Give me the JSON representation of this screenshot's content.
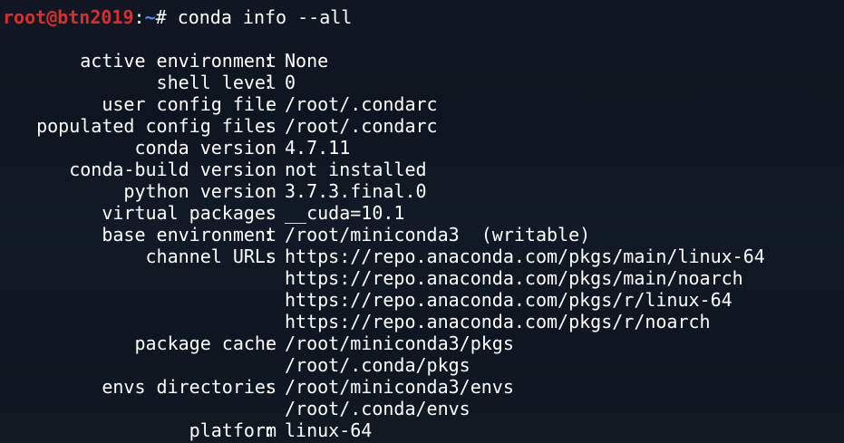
{
  "prompt": {
    "user_host": "root@btn2019",
    "sep": ":",
    "path": "~",
    "symbol": "# ",
    "command": "conda info --all"
  },
  "info": [
    {
      "key": "active environment",
      "value": "None"
    },
    {
      "key": "shell level",
      "value": "0"
    },
    {
      "key": "user config file",
      "value": "/root/.condarc"
    },
    {
      "key": "populated config files",
      "value": "/root/.condarc"
    },
    {
      "key": "conda version",
      "value": "4.7.11"
    },
    {
      "key": "conda-build version",
      "value": "not installed"
    },
    {
      "key": "python version",
      "value": "3.7.3.final.0"
    },
    {
      "key": "virtual packages",
      "value": "__cuda=10.1"
    },
    {
      "key": "base environment",
      "value": "/root/miniconda3  (writable)"
    },
    {
      "key": "channel URLs",
      "value": "https://repo.anaconda.com/pkgs/main/linux-64"
    },
    {
      "key": "",
      "value": "https://repo.anaconda.com/pkgs/main/noarch"
    },
    {
      "key": "",
      "value": "https://repo.anaconda.com/pkgs/r/linux-64"
    },
    {
      "key": "",
      "value": "https://repo.anaconda.com/pkgs/r/noarch"
    },
    {
      "key": "package cache",
      "value": "/root/miniconda3/pkgs"
    },
    {
      "key": "",
      "value": "/root/.conda/pkgs"
    },
    {
      "key": "envs directories",
      "value": "/root/miniconda3/envs"
    },
    {
      "key": "",
      "value": "/root/.conda/envs"
    },
    {
      "key": "platform",
      "value": "linux-64"
    }
  ],
  "colors": {
    "background": "#0f1823",
    "user_host": "#e22a2a",
    "path": "#4d8df2",
    "text": "#ffffff"
  }
}
